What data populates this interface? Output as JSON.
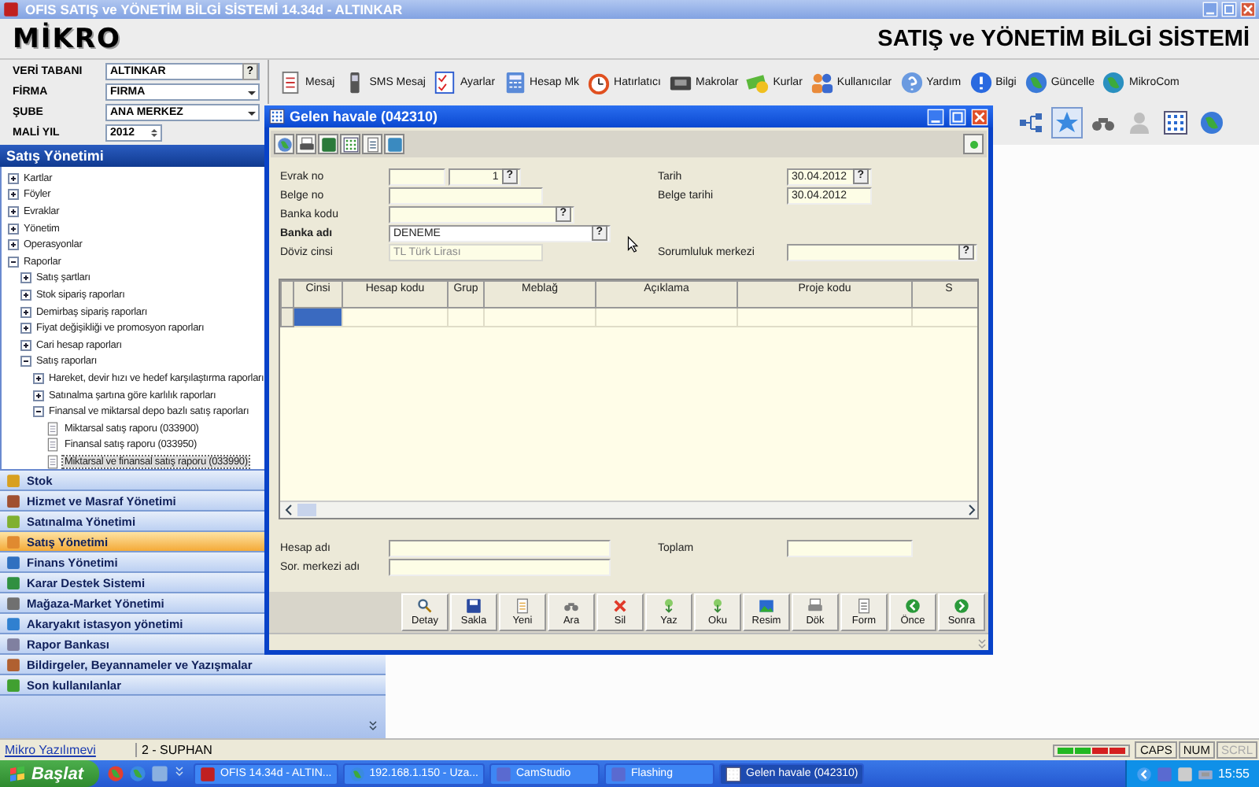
{
  "window": {
    "title": "OFIS SATIŞ ve YÖNETİM BİLGİ SİSTEMİ 14.34d - ALTINKAR"
  },
  "header": {
    "logo": "MİKRO",
    "title": "SATIŞ ve YÖNETİM BİLGİ SİSTEMİ"
  },
  "context_fields": [
    {
      "label": "VERİ TABANI",
      "value": "ALTINKAR",
      "kind": "lookup",
      "lookup": "?"
    },
    {
      "label": "FİRMA",
      "value": "FIRMA",
      "kind": "dropdown"
    },
    {
      "label": "ŞUBE",
      "value": "ANA MERKEZ",
      "kind": "dropdown"
    },
    {
      "label": "MALİ YIL",
      "value": "2012",
      "kind": "spinner"
    }
  ],
  "module_panel": {
    "title": "Satış Yönetimi",
    "tree": [
      {
        "label": "Kartlar",
        "kind": "folder",
        "expanded": false,
        "selected": false
      },
      {
        "label": "Föyler",
        "kind": "folder",
        "expanded": false,
        "selected": false
      },
      {
        "label": "Evraklar",
        "kind": "folder",
        "expanded": false,
        "selected": false
      },
      {
        "label": "Yönetim",
        "kind": "folder",
        "expanded": false,
        "selected": false
      },
      {
        "label": "Operasyonlar",
        "kind": "folder",
        "expanded": false,
        "selected": false
      },
      {
        "label": "Raporlar",
        "kind": "folder",
        "expanded": true,
        "selected": false,
        "children": [
          {
            "label": "Satış şartları",
            "kind": "folder",
            "expanded": false,
            "selected": false
          },
          {
            "label": "Stok sipariş raporları",
            "kind": "folder",
            "expanded": false,
            "selected": false
          },
          {
            "label": "Demirbaş sipariş raporları",
            "kind": "folder",
            "expanded": false,
            "selected": false
          },
          {
            "label": "Fiyat değişikliği ve promosyon raporları",
            "kind": "folder",
            "expanded": false,
            "selected": false
          },
          {
            "label": "Cari hesap raporları",
            "kind": "folder",
            "expanded": false,
            "selected": false
          },
          {
            "label": "Satış raporları",
            "kind": "folder",
            "expanded": true,
            "selected": false,
            "children": [
              {
                "label": "Hareket, devir hızı ve hedef karşılaştırma raporları",
                "kind": "folder",
                "expanded": false,
                "selected": false
              },
              {
                "label": "Satınalma şartına göre karlılık raporları",
                "kind": "folder",
                "expanded": false,
                "selected": false
              },
              {
                "label": "Finansal ve miktarsal depo bazlı satış raporları",
                "kind": "folder",
                "expanded": true,
                "selected": false,
                "children": [
                  {
                    "label": "Miktarsal satış raporu (033900)",
                    "kind": "report",
                    "selected": false
                  },
                  {
                    "label": "Finansal satış raporu (033950)",
                    "kind": "report",
                    "selected": false
                  },
                  {
                    "label": "Miktarsal ve finansal satış raporu (033990)",
                    "kind": "report",
                    "selected": true
                  }
                ]
              }
            ]
          }
        ]
      }
    ]
  },
  "modules": [
    {
      "label": "Stok",
      "selected": false
    },
    {
      "label": "Hizmet ve Masraf Yönetimi",
      "selected": false
    },
    {
      "label": "Satınalma Yönetimi",
      "selected": false
    },
    {
      "label": "Satış Yönetimi",
      "selected": true
    },
    {
      "label": "Finans Yönetimi",
      "selected": false
    },
    {
      "label": "Karar Destek Sistemi",
      "selected": false
    },
    {
      "label": "Mağaza-Market Yönetimi",
      "selected": false
    },
    {
      "label": "Akaryakıt istasyon yönetimi",
      "selected": false
    },
    {
      "label": "Rapor Bankası",
      "selected": false
    },
    {
      "label": "Bildirgeler, Beyannameler ve Yazışmalar",
      "selected": false
    },
    {
      "label": "Son kullanılanlar",
      "selected": false
    }
  ],
  "toolbar": [
    "Mesaj",
    "SMS Mesaj",
    "Ayarlar",
    "Hesap Mk",
    "Hatırlatıcı",
    "Makrolar",
    "Kurlar",
    "Kullanıcılar",
    "Yardım",
    "Bilgi",
    "Güncelle",
    "MikroCom"
  ],
  "view_tools": [
    {
      "selected": false,
      "disabled": false
    },
    {
      "selected": true,
      "disabled": false
    },
    {
      "selected": false,
      "disabled": false
    },
    {
      "selected": false,
      "disabled": true
    },
    {
      "selected": false,
      "disabled": false
    },
    {
      "selected": false,
      "disabled": false
    }
  ],
  "dialog": {
    "title": "Gelen havale (042310)",
    "form_rows": [
      {
        "left": {
          "label": "Evrak no",
          "kind": "serial",
          "value": "1",
          "lookup": "?",
          "required": false,
          "disabled": false,
          "focused": false
        },
        "right": {
          "label": "Tarih",
          "kind": "text",
          "value": "30.04.2012",
          "lookup": "?",
          "required": false,
          "disabled": false,
          "focused": false
        }
      },
      {
        "left": {
          "label": "Belge no",
          "kind": "text",
          "required": false,
          "disabled": false,
          "focused": false
        },
        "right": {
          "label": "Belge tarihi",
          "kind": "text",
          "value": "30.04.2012",
          "required": false,
          "disabled": false,
          "focused": false
        }
      },
      {
        "left": {
          "label": "Banka kodu",
          "kind": "text",
          "lookup": "?",
          "required": false,
          "disabled": false,
          "focused": false
        }
      },
      {
        "left": {
          "label": "Banka adı",
          "kind": "text",
          "value": "DENEME",
          "lookup": "?",
          "required": true,
          "disabled": false,
          "focused": true
        }
      },
      {
        "left": {
          "label": "Döviz cinsi",
          "kind": "text",
          "value": "TL  Türk Lirası",
          "required": false,
          "disabled": true,
          "focused": false
        },
        "right": {
          "label": "Sorumluluk merkezi",
          "kind": "text",
          "lookup": "?",
          "required": false,
          "disabled": false,
          "focused": false
        }
      }
    ],
    "grid": {
      "columns": [
        "Cinsi",
        "Hesap kodu",
        "Grup",
        "Meblağ",
        "Açıklama",
        "Proje kodu",
        "S"
      ],
      "rows": [
        {
          "cells": [
            {
              "selected": true
            },
            {
              "selected": false
            },
            {
              "selected": false
            },
            {
              "selected": false
            },
            {
              "selected": false
            },
            {
              "selected": false
            },
            {
              "selected": false
            }
          ]
        }
      ]
    },
    "summary_fields": [
      {
        "label": "Hesap adı"
      },
      {
        "label": "Sor. merkezi adı"
      },
      {
        "label": "Toplam"
      }
    ],
    "buttons": [
      "Detay",
      "Sakla",
      "Yeni",
      "Ara",
      "Sil",
      "Yaz",
      "Oku",
      "Resim",
      "Dök",
      "Form",
      "Önce",
      "Sonra"
    ]
  },
  "status_bar": {
    "link": "Mikro Yazılımevi",
    "user": "2 - SUPHAN",
    "indicators": [
      {
        "color": "#22b822"
      },
      {
        "color": "#22b822"
      },
      {
        "color": "#d42020"
      },
      {
        "color": "#d42020"
      }
    ],
    "keys": [
      {
        "label": "CAPS",
        "on": true
      },
      {
        "label": "NUM",
        "on": true
      },
      {
        "label": "SCRL",
        "on": false
      }
    ]
  },
  "taskbar": {
    "start": "Başlat",
    "tasks": [
      {
        "label": "OFIS 14.34d - ALTIN...",
        "selected": false
      },
      {
        "label": "192.168.1.150 - Uza...",
        "selected": false
      },
      {
        "label": "CamStudio",
        "selected": false
      },
      {
        "label": "Flashing",
        "selected": false
      },
      {
        "label": "Gelen havale (042310)",
        "selected": true
      }
    ],
    "clock": "15:55"
  }
}
